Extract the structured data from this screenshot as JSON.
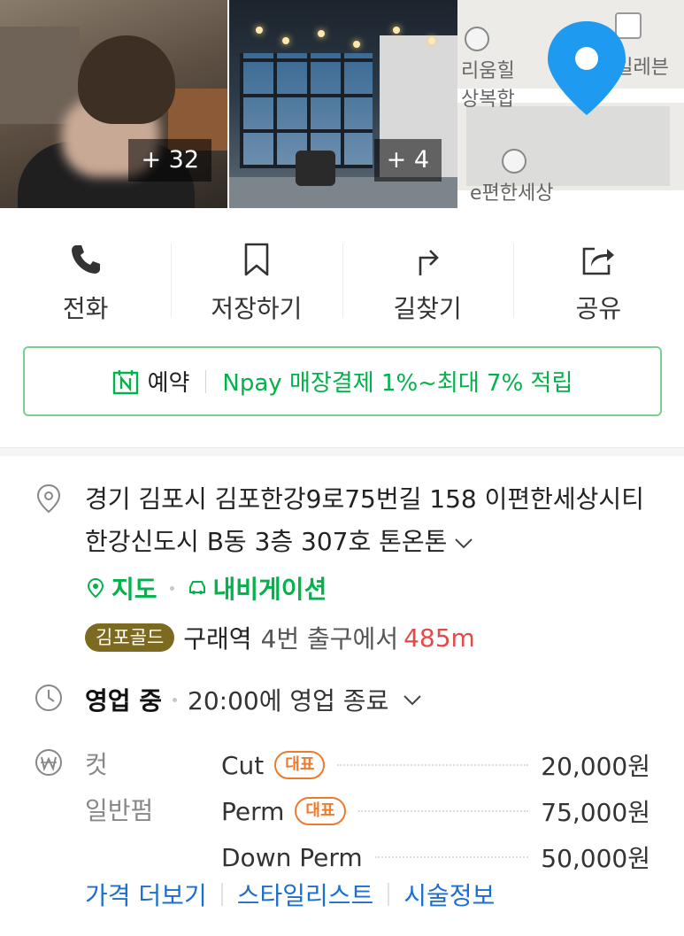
{
  "photos": [
    {
      "count": "+ 32"
    },
    {
      "count": "+ 4"
    }
  ],
  "map": {
    "labels": [
      "리움힐",
      "상복합",
      "븐일레븐",
      "e편한세상"
    ]
  },
  "actions": {
    "call": "전화",
    "save": "저장하기",
    "directions": "길찾기",
    "share": "공유"
  },
  "reservation": {
    "label": "예약",
    "promo": "Npay 매장결제 1%~최대 7% 적립"
  },
  "address": {
    "text": "경기 김포시 김포한강9로75번길 158 이편한세상시티 한강신도시 B동 3층 307호 톤온톤",
    "links": {
      "map": "지도",
      "navigation": "내비게이션"
    }
  },
  "subway": {
    "line": "김포골드",
    "station": "구래역",
    "exit": "4번 출구에서",
    "distance": "485m"
  },
  "hours": {
    "status": "영업 중",
    "text": "20:00에 영업 종료"
  },
  "prices": {
    "categories": [
      "컷",
      "일반펌"
    ],
    "items": [
      {
        "name": "Cut",
        "badge": "대표",
        "price": "20,000원"
      },
      {
        "name": "Perm",
        "badge": "대표",
        "price": "75,000원"
      },
      {
        "name": "Down Perm",
        "badge": "",
        "price": "50,000원"
      }
    ]
  },
  "more": {
    "price_more": "가격 더보기",
    "stylist": "스타일리스트",
    "treatment": "시술정보"
  },
  "colors": {
    "accent_green": "#02b24b",
    "link_blue": "#1a6fd1",
    "distance_red": "#e24b4b",
    "badge_orange": "#ee7a2d",
    "line_badge": "#7d6a21"
  }
}
